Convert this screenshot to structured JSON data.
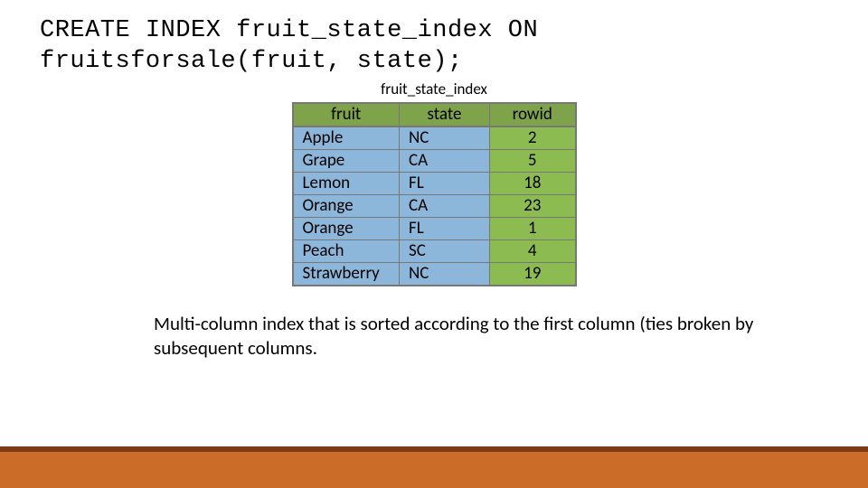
{
  "sql": "CREATE INDEX fruit_state_index ON fruitsforsale(fruit, state);",
  "table_title": "fruit_state_index",
  "headers": {
    "fruit": "fruit",
    "state": "state",
    "rowid": "rowid"
  },
  "rows": [
    {
      "fruit": "Apple",
      "state": "NC",
      "rowid": "2"
    },
    {
      "fruit": "Grape",
      "state": "CA",
      "rowid": "5"
    },
    {
      "fruit": "Lemon",
      "state": "FL",
      "rowid": "18"
    },
    {
      "fruit": "Orange",
      "state": "CA",
      "rowid": "23"
    },
    {
      "fruit": "Orange",
      "state": "FL",
      "rowid": "1"
    },
    {
      "fruit": "Peach",
      "state": "SC",
      "rowid": "4"
    },
    {
      "fruit": "Strawberry",
      "state": "NC",
      "rowid": "19"
    }
  ],
  "caption": "Multi-column index that is sorted according to the first column (ties broken by subsequent columns."
}
